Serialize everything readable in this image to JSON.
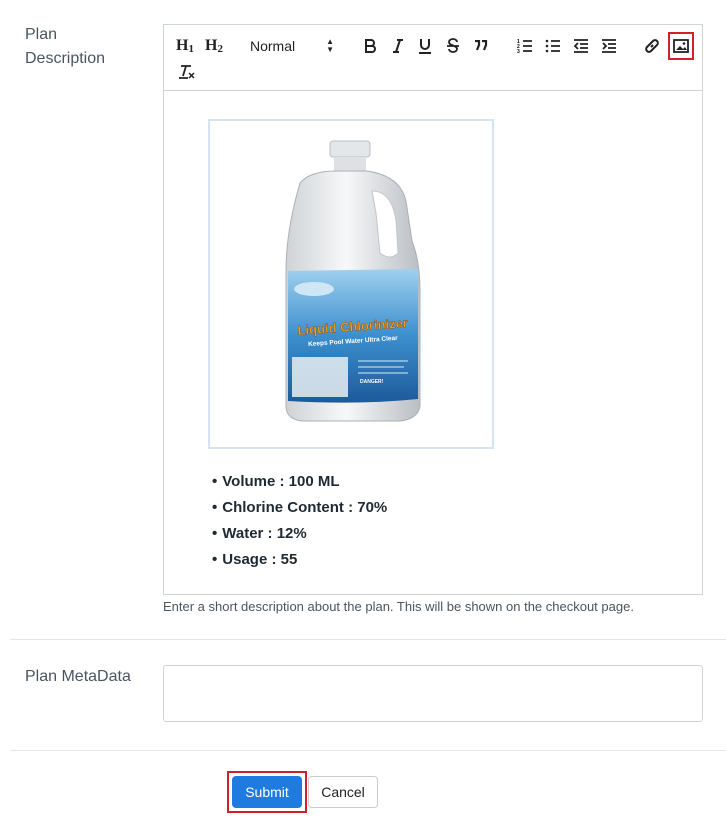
{
  "form": {
    "description_label": "Plan Description",
    "description_help": "Enter a short description about the plan. This will be shown on the checkout page.",
    "metadata_label": "Plan MetaData",
    "metadata_value": ""
  },
  "toolbar": {
    "h1": "H",
    "h1_sub": "1",
    "h2": "H",
    "h2_sub": "2",
    "format_select": "Normal",
    "buttons": [
      "bold-icon",
      "italic-icon",
      "underline-icon",
      "strike-icon",
      "quote-icon",
      "ordered-list-icon",
      "bullet-list-icon",
      "outdent-icon",
      "indent-icon",
      "link-icon",
      "image-icon",
      "clear-format-icon"
    ]
  },
  "content": {
    "product_image": {
      "brand_text": "Liquid Chlorinizer",
      "tagline": "Keeps Pool Water Ultra Clear",
      "warning": "DANGER!"
    },
    "bullets": [
      "Volume : 100 ML",
      "Chlorine Content : 70%",
      "Water : 12%",
      "Usage : 55"
    ]
  },
  "actions": {
    "submit": "Submit",
    "cancel": "Cancel"
  },
  "colors": {
    "primary": "#1f7be0",
    "highlight": "#d0202a",
    "border": "#cfd4d9"
  }
}
